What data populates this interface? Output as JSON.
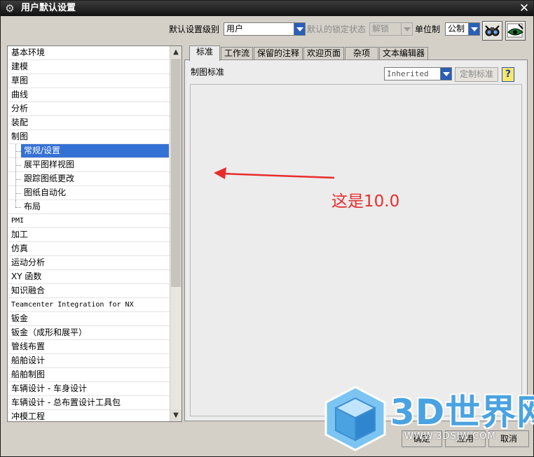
{
  "window": {
    "title": "用户默认设置"
  },
  "toolbar": {
    "level_label": "默认设置级别",
    "level_value": "用户",
    "lock_label": "默认的锁定状态",
    "lock_value": "解锁",
    "unit_label": "单位制",
    "unit_value": "公制"
  },
  "tree": {
    "items": [
      "基本环境",
      "建模",
      "草图",
      "曲线",
      "分析",
      "装配",
      "制图",
      "常规/设置",
      "展平图样视图",
      "跟踪图纸更改",
      "图纸自动化",
      "布局",
      "PMI",
      "加工",
      "仿真",
      "运动分析",
      "XY 函数",
      "知识融合",
      "Teamcenter Integration for NX",
      "钣金",
      "钣金（成形和展平）",
      "管线布置",
      "船舶设计",
      "船舶制图",
      "车辆设计 - 车身设计",
      "车辆设计 - 总布置设计工具包",
      "冲模工程"
    ],
    "selected": "常规/设置"
  },
  "tabs": [
    "标准",
    "工作流",
    "保留的注释",
    "欢迎页面",
    "杂项",
    "文本编辑器"
  ],
  "panel": {
    "label": "制图标准",
    "standard_value": "Inherited",
    "custom_button": "定制标准",
    "help": "?"
  },
  "annotation": {
    "text": "这是10.0"
  },
  "footer": {
    "buttons": [
      "确定",
      "应用",
      "取消"
    ]
  },
  "watermark": {
    "text": "3D世界网",
    "url": "WWW.3DSJW.COM"
  },
  "colors": {
    "selection": "#3471d4",
    "annotation": "#e82c2c",
    "arrow_blue": "#2a5fb8"
  },
  "icons": [
    "gear-icon",
    "close-icon",
    "binoculars-icon",
    "eye-icon",
    "help-icon",
    "arrow-annotation"
  ]
}
